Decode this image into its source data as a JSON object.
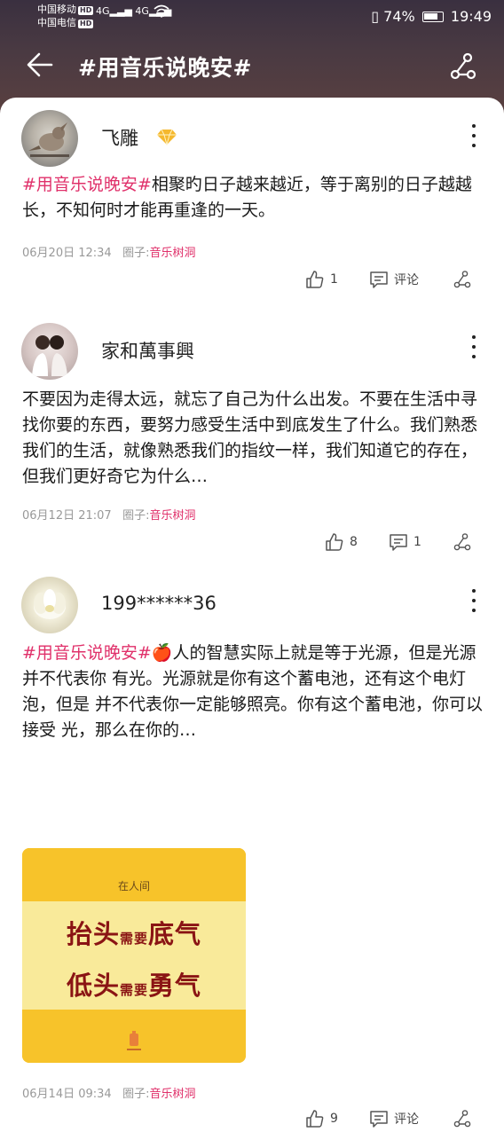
{
  "status_bar": {
    "carrier1": "中国移动",
    "carrier2": "中国电信",
    "hd": "HD",
    "net1": "4G",
    "net2": "4G",
    "battery": "74%",
    "time": "19:49"
  },
  "nav": {
    "title": "#用音乐说晚安#"
  },
  "posts": [
    {
      "username": "飞雕",
      "hashtag": "#用音乐说晚安#",
      "text": "相聚旳日子越来越近，等于离别的日子越越长，不知何时才能再重逢的一天。",
      "date": "06月20日 12:34",
      "circle_label": "圈子:",
      "circle_name": "音乐树洞",
      "likes": "1",
      "comments": "评论"
    },
    {
      "username": "家和萬事興",
      "hashtag": "",
      "text": "不要因为走得太远，就忘了自己为什么出发。不要在生活中寻找你要的东西，要努力感受生活中到底发生了什么。我们熟悉我们的生活，就像熟悉我们的指纹一样，我们知道它的存在，但我们更好奇它为什么…",
      "date": "06月12日 21:07",
      "circle_label": "圈子:",
      "circle_name": "音乐树洞",
      "likes": "8",
      "comments": "1"
    },
    {
      "username": "199******36",
      "hashtag": "#用音乐说晚安#",
      "emoji": "🍎",
      "text": "人的智慧实际上就是等于光源，但是光源并不代表你 有光。光源就是你有这个蓄电池，还有这个电灯泡，但是 并不代表你一定能够照亮。你有这个蓄电池，你可以接受 光，那么在你的…",
      "date": "06月14日 09:34",
      "circle_label": "圈子:",
      "circle_name": "音乐树洞",
      "likes": "9",
      "comments": "评论",
      "image": {
        "small_text": "在人间",
        "line1_a": "抬头",
        "line1_small": "需要",
        "line1_b": "底气",
        "line2_a": "低头",
        "line2_small": "需要",
        "line2_b": "勇气"
      }
    }
  ],
  "colors": {
    "accent": "#e0306a",
    "header_bg": "#3a3040",
    "image_yellow": "#f7c32a",
    "image_light": "#f9ea9a",
    "image_text": "#8a1414"
  }
}
